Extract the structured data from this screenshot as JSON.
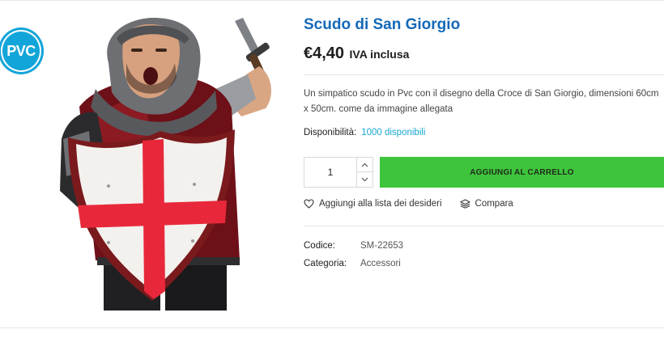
{
  "product": {
    "title": "Scudo di San Giorgio",
    "price": "€4,40",
    "tax_note": "IVA inclusa",
    "description": "Un simpatico scudo in Pvc con il disegno della Croce di San Giorgio, dimensioni 60cm x 50cm. come da immagine allegata",
    "availability_label": "Disponibilità:",
    "availability_value": "1000 disponibili",
    "badge_text": "PVC"
  },
  "purchase": {
    "quantity": "1",
    "add_to_cart_label": "AGGIUNGI AL CARRELLO"
  },
  "actions": {
    "wishlist_label": "Aggiungi alla lista dei desideri",
    "compare_label": "Compara"
  },
  "meta": {
    "sku_label": "Codice:",
    "sku_value": "SM-22653",
    "category_label": "Categoria:",
    "category_value": "Accessori"
  },
  "colors": {
    "title": "#1469b8",
    "accent_button": "#3ec43c",
    "stock": "#19a7d1",
    "badge": "#12a5d9",
    "cross": "#e8283a"
  },
  "icons": {
    "qty_up": "chevron-up-icon",
    "qty_down": "chevron-down-icon",
    "wishlist": "heart-icon",
    "compare": "layers-icon"
  }
}
